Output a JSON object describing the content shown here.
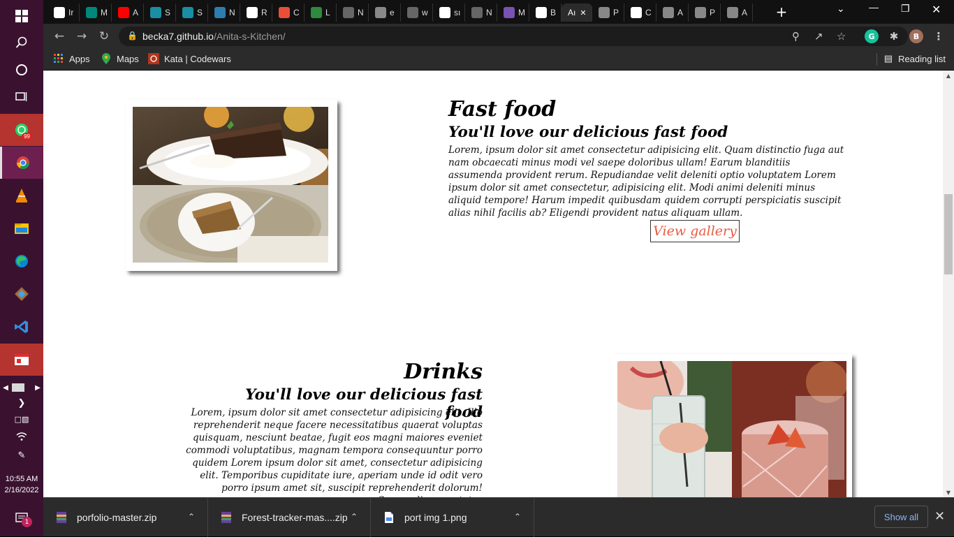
{
  "taskbar": {
    "whatsapp_badge": "99",
    "notification_count": "1",
    "time": "10:55 AM",
    "date": "2/16/2022"
  },
  "tabs": [
    {
      "label": "Ir",
      "icon": "gmail-icon",
      "color": "#ffffff"
    },
    {
      "label": "M",
      "icon": "meet-icon",
      "color": "#00897b"
    },
    {
      "label": "A",
      "icon": "youtube-icon",
      "color": "#ff0000"
    },
    {
      "label": "S",
      "icon": "f-icon",
      "color": "#1a8fa3"
    },
    {
      "label": "S",
      "icon": "f-icon",
      "color": "#1a8fa3"
    },
    {
      "label": "N",
      "icon": "n-icon",
      "color": "#2e7db0"
    },
    {
      "label": "R",
      "icon": "r-icon",
      "color": "#ffffff"
    },
    {
      "label": "C",
      "icon": "colorwheel-icon",
      "color": "#e94f37"
    },
    {
      "label": "L",
      "icon": "w-icon",
      "color": "#2d8a3e"
    },
    {
      "label": "N",
      "icon": "globe-icon",
      "color": "#666666"
    },
    {
      "label": "e",
      "icon": "globe-icon",
      "color": "#888888"
    },
    {
      "label": "w",
      "icon": "globe-icon",
      "color": "#666666"
    },
    {
      "label": "sı",
      "icon": "google-icon",
      "color": "#ffffff"
    },
    {
      "label": "N",
      "icon": "globe-icon",
      "color": "#666666"
    },
    {
      "label": "M",
      "icon": "bootstrap-icon",
      "color": "#7952b3"
    },
    {
      "label": "B",
      "icon": "github-icon",
      "color": "#ffffff"
    },
    {
      "label": "Aı",
      "icon": "",
      "color": "#2b2b2b",
      "active": true
    },
    {
      "label": "P",
      "icon": "globe-icon",
      "color": "#888888"
    },
    {
      "label": "C",
      "icon": "a-icon",
      "color": "#ffffff"
    },
    {
      "label": "A",
      "icon": "globe-icon",
      "color": "#888888"
    },
    {
      "label": "P",
      "icon": "globe-icon",
      "color": "#888888"
    },
    {
      "label": "A",
      "icon": "globe-icon",
      "color": "#888888"
    }
  ],
  "address_bar": {
    "domain": "becka7.github.io",
    "path": "/Anita-s-Kitchen/"
  },
  "profile_initial": "B",
  "bookmarks": [
    {
      "label": "Apps"
    },
    {
      "label": "Maps"
    },
    {
      "label": "Kata | Codewars"
    }
  ],
  "reading_list": "Reading list",
  "page": {
    "fastfood": {
      "title": "Fast food",
      "subtitle": "You'll love our delicious fast food",
      "text": "Lorem, ipsum dolor sit amet consectetur adipisicing elit. Quam distinctio fuga aut nam obcaecati minus modi vel saepe doloribus ullam! Earum blanditiis assumenda provident rerum. Repudiandae velit deleniti optio voluptatem Lorem ipsum dolor sit amet consectetur, adipisicing elit. Modi animi deleniti minus aliquid tempore! Harum impedit quibusdam quidem corrupti perspiciatis suscipit alias nihil facilis ab? Eligendi provident natus aliquam ullam.",
      "button": "View gallery"
    },
    "drinks": {
      "title": "Drinks",
      "subtitle": "You'll love our delicious fast food",
      "text": "Lorem, ipsum dolor sit amet consectetur adipisicing elit. Illo reprehenderit neque facere necessitatibus quaerat voluptas quisquam, nesciunt beatae, fugit eos magni maiores eveniet commodi voluptatibus, magnam tempora consequuntur porro quidem Lorem ipsum dolor sit amet, consectetur adipisicing elit. Temporibus cupiditate iure, aperiam unde id odit vero porro ipsum amet sit, suscipit reprehenderit dolorum! Commodi consectetur"
    },
    "accent_color": "#e65b42"
  },
  "downloads": {
    "items": [
      {
        "name": "porfolio-master.zip"
      },
      {
        "name": "Forest-tracker-mas....zip"
      },
      {
        "name": "port img 1.png"
      }
    ],
    "show_all": "Show all"
  }
}
